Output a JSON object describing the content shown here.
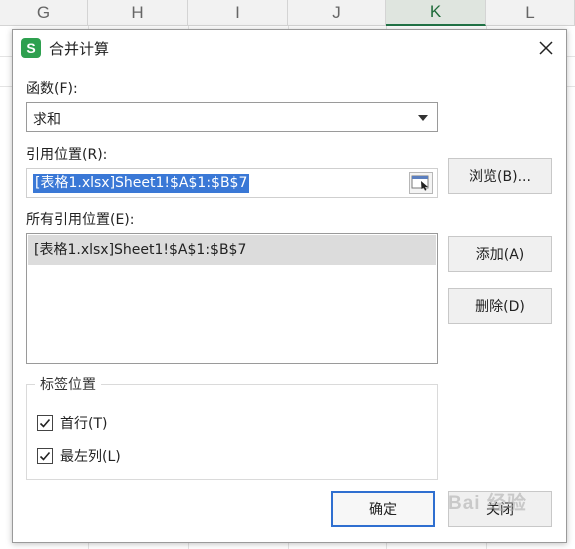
{
  "spreadsheet": {
    "columns": [
      "G",
      "H",
      "I",
      "J",
      "K",
      "L"
    ],
    "selected_column": "K"
  },
  "dialog": {
    "title": "合并计算",
    "app_icon_letter": "S",
    "function_label": "函数(F):",
    "function_value": "求和",
    "reference_label": "引用位置(R):",
    "reference_value": "[表格1.xlsx]Sheet1!$A$1:$B$7",
    "browse_button": "浏览(B)...",
    "all_references_label": "所有引用位置(E):",
    "all_references": [
      "[表格1.xlsx]Sheet1!$A$1:$B$7"
    ],
    "add_button": "添加(A)",
    "delete_button": "删除(D)",
    "label_position_title": "标签位置",
    "first_row_label": "首行(T)",
    "first_row_checked": true,
    "left_column_label": "最左列(L)",
    "left_column_checked": true,
    "ok_button": "确定",
    "close_button": "关闭"
  },
  "watermark_text": "Bai 经验",
  "colors": {
    "selection": "#3a78d6",
    "primary_border": "#2f6fd0",
    "app_icon": "#2ea04f",
    "selected_column_accent": "#217346"
  }
}
